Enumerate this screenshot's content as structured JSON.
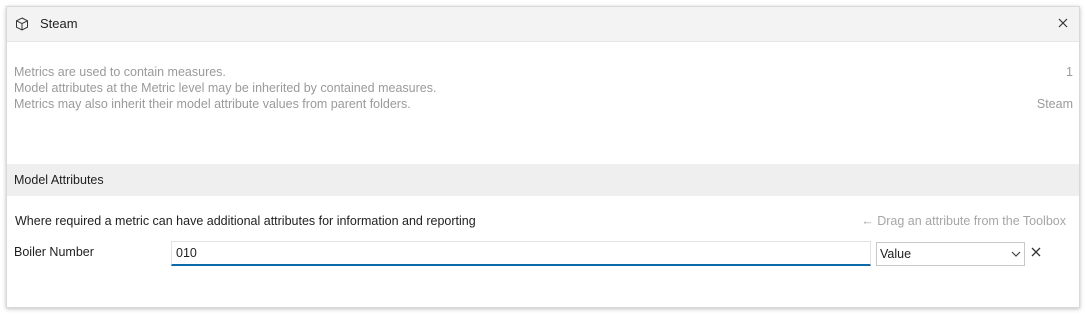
{
  "window": {
    "title": "Steam",
    "icon": "cube-icon",
    "close_icon": "close-icon"
  },
  "info": {
    "lines": [
      "Metrics are used to contain measures.",
      "Model attributes at the Metric level may be inherited by contained measures.",
      "Metrics may also inherit their model attribute values from parent folders."
    ],
    "right_values": [
      "1",
      "Steam"
    ]
  },
  "model_attributes": {
    "section_title": "Model Attributes",
    "description": "Where required a metric can have additional attributes for information and reporting",
    "toolbox_hint": "← Drag an attribute from the Toolbox",
    "rows": [
      {
        "label": "Boiler Number",
        "value": "010",
        "type_selected": "Value",
        "remove_icon": "x-icon"
      }
    ]
  },
  "colors": {
    "accent": "#0b6aa8",
    "muted_text": "#9a9a9a",
    "section_bg": "#efefef"
  }
}
